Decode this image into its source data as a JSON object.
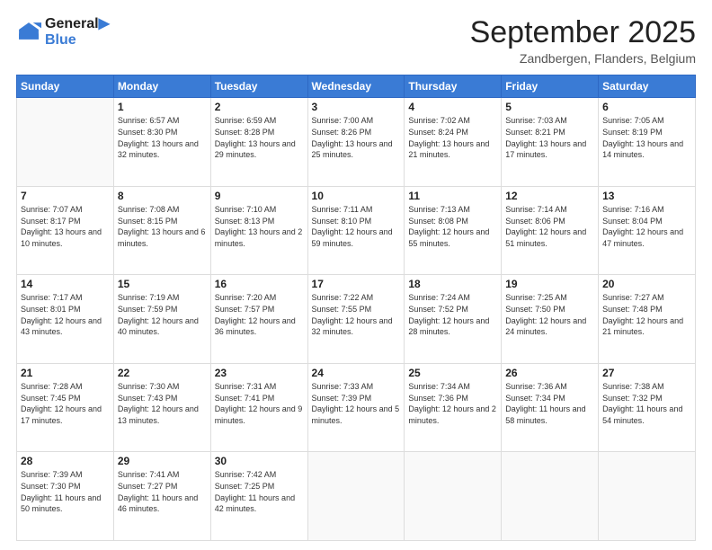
{
  "logo": {
    "line1": "General",
    "line2": "Blue"
  },
  "title": "September 2025",
  "subtitle": "Zandbergen, Flanders, Belgium",
  "days": [
    "Sunday",
    "Monday",
    "Tuesday",
    "Wednesday",
    "Thursday",
    "Friday",
    "Saturday"
  ],
  "weeks": [
    [
      {
        "num": "",
        "sunrise": "",
        "sunset": "",
        "daylight": ""
      },
      {
        "num": "1",
        "sunrise": "Sunrise: 6:57 AM",
        "sunset": "Sunset: 8:30 PM",
        "daylight": "Daylight: 13 hours and 32 minutes."
      },
      {
        "num": "2",
        "sunrise": "Sunrise: 6:59 AM",
        "sunset": "Sunset: 8:28 PM",
        "daylight": "Daylight: 13 hours and 29 minutes."
      },
      {
        "num": "3",
        "sunrise": "Sunrise: 7:00 AM",
        "sunset": "Sunset: 8:26 PM",
        "daylight": "Daylight: 13 hours and 25 minutes."
      },
      {
        "num": "4",
        "sunrise": "Sunrise: 7:02 AM",
        "sunset": "Sunset: 8:24 PM",
        "daylight": "Daylight: 13 hours and 21 minutes."
      },
      {
        "num": "5",
        "sunrise": "Sunrise: 7:03 AM",
        "sunset": "Sunset: 8:21 PM",
        "daylight": "Daylight: 13 hours and 17 minutes."
      },
      {
        "num": "6",
        "sunrise": "Sunrise: 7:05 AM",
        "sunset": "Sunset: 8:19 PM",
        "daylight": "Daylight: 13 hours and 14 minutes."
      }
    ],
    [
      {
        "num": "7",
        "sunrise": "Sunrise: 7:07 AM",
        "sunset": "Sunset: 8:17 PM",
        "daylight": "Daylight: 13 hours and 10 minutes."
      },
      {
        "num": "8",
        "sunrise": "Sunrise: 7:08 AM",
        "sunset": "Sunset: 8:15 PM",
        "daylight": "Daylight: 13 hours and 6 minutes."
      },
      {
        "num": "9",
        "sunrise": "Sunrise: 7:10 AM",
        "sunset": "Sunset: 8:13 PM",
        "daylight": "Daylight: 13 hours and 2 minutes."
      },
      {
        "num": "10",
        "sunrise": "Sunrise: 7:11 AM",
        "sunset": "Sunset: 8:10 PM",
        "daylight": "Daylight: 12 hours and 59 minutes."
      },
      {
        "num": "11",
        "sunrise": "Sunrise: 7:13 AM",
        "sunset": "Sunset: 8:08 PM",
        "daylight": "Daylight: 12 hours and 55 minutes."
      },
      {
        "num": "12",
        "sunrise": "Sunrise: 7:14 AM",
        "sunset": "Sunset: 8:06 PM",
        "daylight": "Daylight: 12 hours and 51 minutes."
      },
      {
        "num": "13",
        "sunrise": "Sunrise: 7:16 AM",
        "sunset": "Sunset: 8:04 PM",
        "daylight": "Daylight: 12 hours and 47 minutes."
      }
    ],
    [
      {
        "num": "14",
        "sunrise": "Sunrise: 7:17 AM",
        "sunset": "Sunset: 8:01 PM",
        "daylight": "Daylight: 12 hours and 43 minutes."
      },
      {
        "num": "15",
        "sunrise": "Sunrise: 7:19 AM",
        "sunset": "Sunset: 7:59 PM",
        "daylight": "Daylight: 12 hours and 40 minutes."
      },
      {
        "num": "16",
        "sunrise": "Sunrise: 7:20 AM",
        "sunset": "Sunset: 7:57 PM",
        "daylight": "Daylight: 12 hours and 36 minutes."
      },
      {
        "num": "17",
        "sunrise": "Sunrise: 7:22 AM",
        "sunset": "Sunset: 7:55 PM",
        "daylight": "Daylight: 12 hours and 32 minutes."
      },
      {
        "num": "18",
        "sunrise": "Sunrise: 7:24 AM",
        "sunset": "Sunset: 7:52 PM",
        "daylight": "Daylight: 12 hours and 28 minutes."
      },
      {
        "num": "19",
        "sunrise": "Sunrise: 7:25 AM",
        "sunset": "Sunset: 7:50 PM",
        "daylight": "Daylight: 12 hours and 24 minutes."
      },
      {
        "num": "20",
        "sunrise": "Sunrise: 7:27 AM",
        "sunset": "Sunset: 7:48 PM",
        "daylight": "Daylight: 12 hours and 21 minutes."
      }
    ],
    [
      {
        "num": "21",
        "sunrise": "Sunrise: 7:28 AM",
        "sunset": "Sunset: 7:45 PM",
        "daylight": "Daylight: 12 hours and 17 minutes."
      },
      {
        "num": "22",
        "sunrise": "Sunrise: 7:30 AM",
        "sunset": "Sunset: 7:43 PM",
        "daylight": "Daylight: 12 hours and 13 minutes."
      },
      {
        "num": "23",
        "sunrise": "Sunrise: 7:31 AM",
        "sunset": "Sunset: 7:41 PM",
        "daylight": "Daylight: 12 hours and 9 minutes."
      },
      {
        "num": "24",
        "sunrise": "Sunrise: 7:33 AM",
        "sunset": "Sunset: 7:39 PM",
        "daylight": "Daylight: 12 hours and 5 minutes."
      },
      {
        "num": "25",
        "sunrise": "Sunrise: 7:34 AM",
        "sunset": "Sunset: 7:36 PM",
        "daylight": "Daylight: 12 hours and 2 minutes."
      },
      {
        "num": "26",
        "sunrise": "Sunrise: 7:36 AM",
        "sunset": "Sunset: 7:34 PM",
        "daylight": "Daylight: 11 hours and 58 minutes."
      },
      {
        "num": "27",
        "sunrise": "Sunrise: 7:38 AM",
        "sunset": "Sunset: 7:32 PM",
        "daylight": "Daylight: 11 hours and 54 minutes."
      }
    ],
    [
      {
        "num": "28",
        "sunrise": "Sunrise: 7:39 AM",
        "sunset": "Sunset: 7:30 PM",
        "daylight": "Daylight: 11 hours and 50 minutes."
      },
      {
        "num": "29",
        "sunrise": "Sunrise: 7:41 AM",
        "sunset": "Sunset: 7:27 PM",
        "daylight": "Daylight: 11 hours and 46 minutes."
      },
      {
        "num": "30",
        "sunrise": "Sunrise: 7:42 AM",
        "sunset": "Sunset: 7:25 PM",
        "daylight": "Daylight: 11 hours and 42 minutes."
      },
      {
        "num": "",
        "sunrise": "",
        "sunset": "",
        "daylight": ""
      },
      {
        "num": "",
        "sunrise": "",
        "sunset": "",
        "daylight": ""
      },
      {
        "num": "",
        "sunrise": "",
        "sunset": "",
        "daylight": ""
      },
      {
        "num": "",
        "sunrise": "",
        "sunset": "",
        "daylight": ""
      }
    ]
  ]
}
